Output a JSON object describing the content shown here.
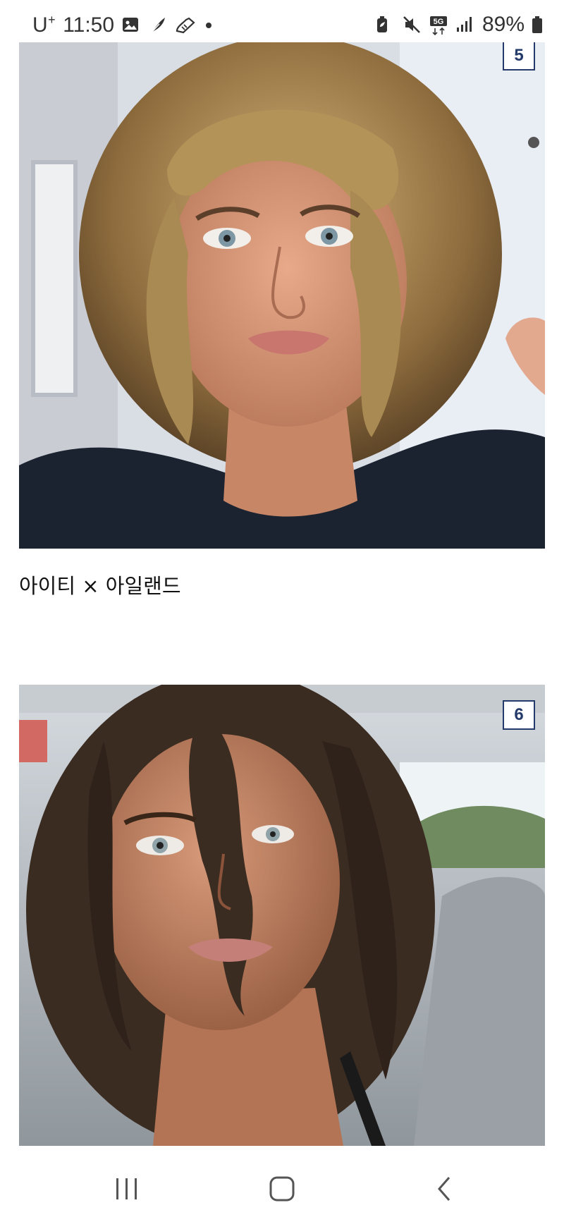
{
  "status_bar": {
    "carrier": "U",
    "carrier_sup": "+",
    "time": "11:50",
    "battery": "89%"
  },
  "posts": [
    {
      "number": "5",
      "caption": "아이티 × 아일랜드"
    },
    {
      "number": "6"
    }
  ],
  "nav": {
    "recents_icon": "recents-icon",
    "home_icon": "home-icon",
    "back_icon": "back-icon"
  },
  "colors": {
    "badge_border": "#243a6b",
    "background": "#ffffff"
  }
}
